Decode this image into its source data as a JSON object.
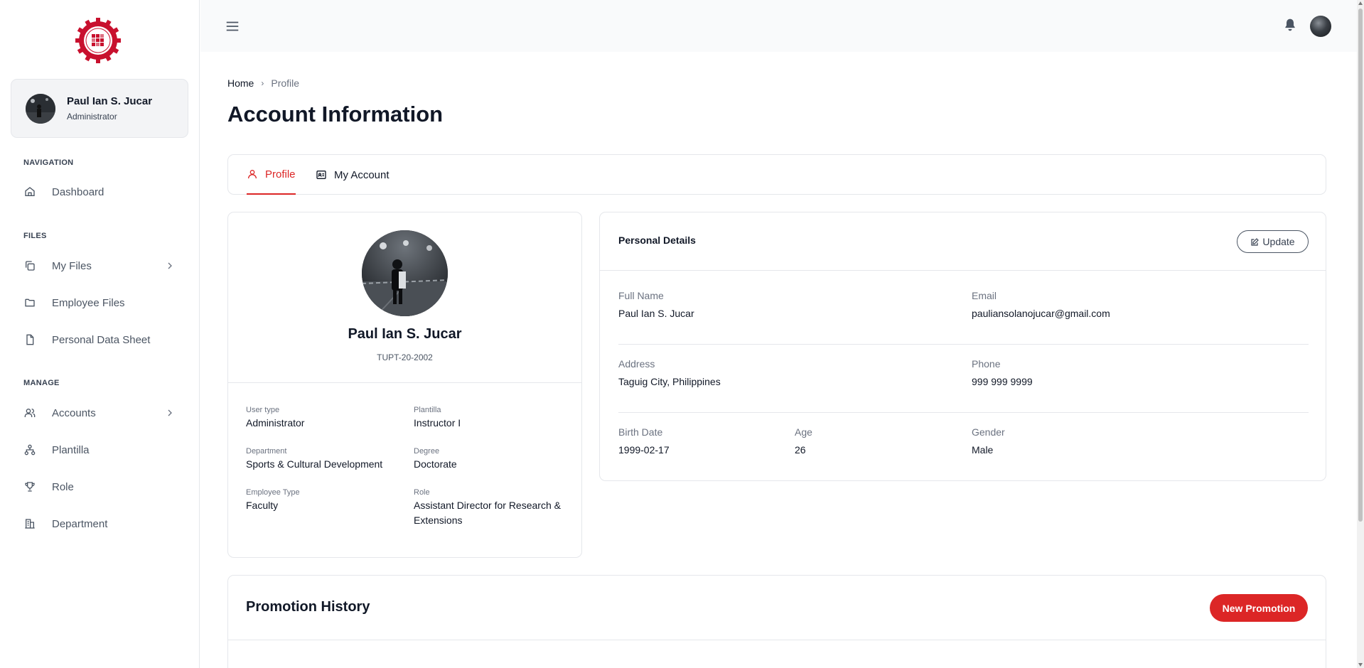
{
  "sidebar": {
    "user": {
      "name": "Paul Ian S. Jucar",
      "role": "Administrator"
    },
    "sections": {
      "navigation": "NAVIGATION",
      "files": "FILES",
      "manage": "MANAGE"
    },
    "items": {
      "dashboard": {
        "label": "Dashboard",
        "icon": "home-icon"
      },
      "my_files": {
        "label": "My Files",
        "icon": "copy-icon"
      },
      "employee_files": {
        "label": "Employee Files",
        "icon": "folder-icon"
      },
      "pds": {
        "label": "Personal Data Sheet",
        "icon": "file-icon"
      },
      "accounts": {
        "label": "Accounts",
        "icon": "users-icon"
      },
      "plantilla": {
        "label": "Plantilla",
        "icon": "sitemap-icon"
      },
      "role": {
        "label": "Role",
        "icon": "trophy-icon"
      },
      "department": {
        "label": "Department",
        "icon": "building-icon"
      }
    }
  },
  "breadcrumb": {
    "home": "Home",
    "current": "Profile"
  },
  "page_title": "Account Information",
  "tabs": [
    {
      "label": "Profile",
      "icon": "user-icon",
      "active": true
    },
    {
      "label": "My Account",
      "icon": "id-card-icon",
      "active": false
    }
  ],
  "profile": {
    "name": "Paul Ian S. Jucar",
    "id": "TUPT-20-2002",
    "fields": {
      "user_type": {
        "label": "User type",
        "value": "Administrator"
      },
      "plantilla": {
        "label": "Plantilla",
        "value": "Instructor I"
      },
      "department": {
        "label": "Department",
        "value": "Sports & Cultural Development"
      },
      "degree": {
        "label": "Degree",
        "value": "Doctorate"
      },
      "employee_type": {
        "label": "Employee Type",
        "value": "Faculty"
      },
      "role": {
        "label": "Role",
        "value": "Assistant Director for Research & Extensions"
      }
    }
  },
  "personal_details": {
    "title": "Personal Details",
    "update_label": "Update",
    "full_name": {
      "label": "Full Name",
      "value": "Paul Ian S. Jucar"
    },
    "email": {
      "label": "Email",
      "value": "pauliansolanojucar@gmail.com"
    },
    "address": {
      "label": "Address",
      "value": "Taguig City, Philippines"
    },
    "phone": {
      "label": "Phone",
      "value": "999 999 9999"
    },
    "birth_date": {
      "label": "Birth Date",
      "value": "1999-02-17"
    },
    "age": {
      "label": "Age",
      "value": "26"
    },
    "gender": {
      "label": "Gender",
      "value": "Male"
    }
  },
  "promotion": {
    "title": "Promotion History",
    "button_label": "New Promotion"
  },
  "colors": {
    "accent": "#dc2626",
    "text": "#111827",
    "muted": "#6b7280",
    "border": "#e5e7eb"
  }
}
